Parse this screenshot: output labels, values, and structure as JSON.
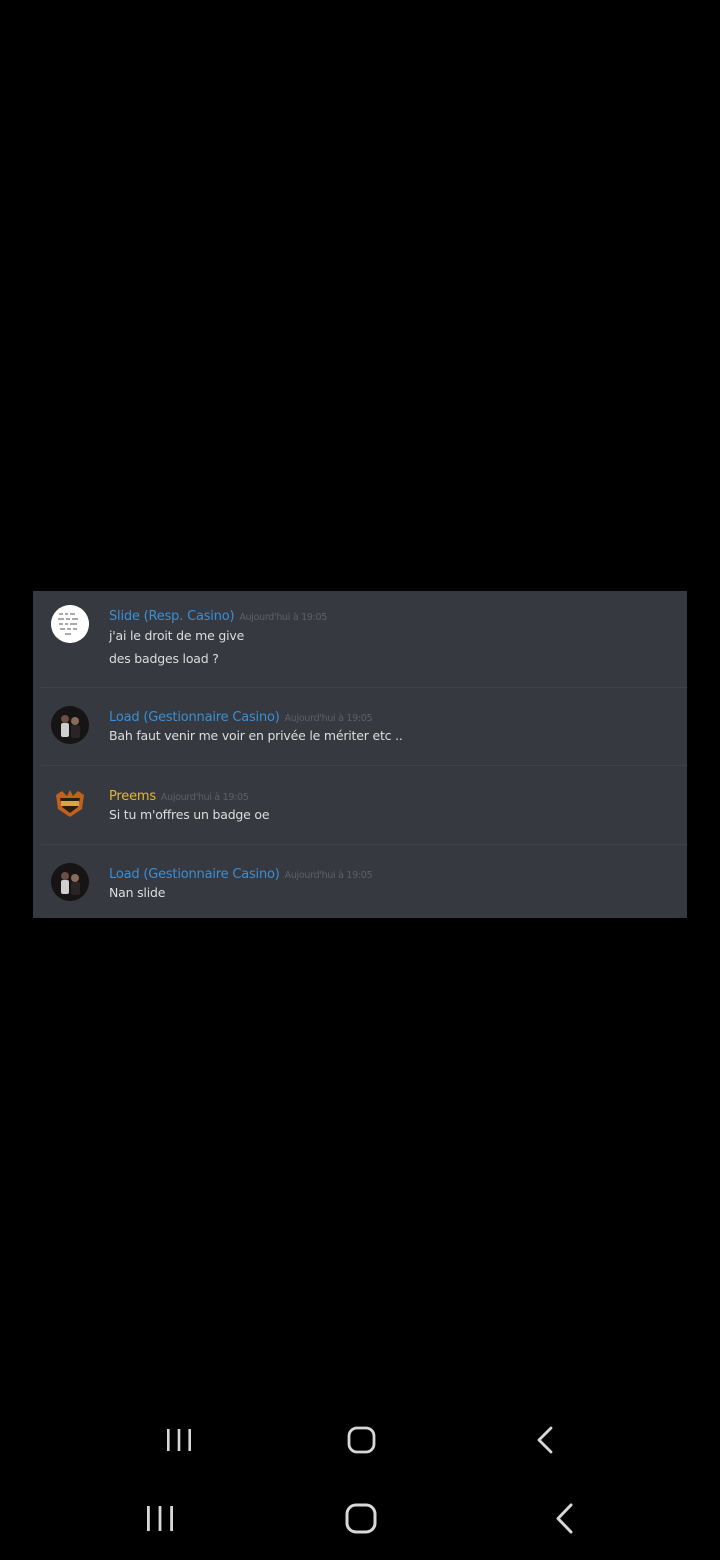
{
  "colors": {
    "background": "#000000",
    "panel": "#36393f",
    "divider": "#3f4248",
    "message_text": "#dcddde",
    "timestamp": "#5d6168",
    "role_blue": "#3a8fd6",
    "role_gold": "#e2b92b",
    "nav_icon": "#d8d8d8"
  },
  "chat": {
    "messages": [
      {
        "author": "Slide (Resp. Casino)",
        "author_color": "#3a8fd6",
        "timestamp": "Aujourd'hui à 19:05",
        "avatar": "scribble-text-avatar",
        "lines": [
          "j'ai le droit de me give",
          "des badges load ?"
        ]
      },
      {
        "author": "Load (Gestionnaire Casino)",
        "author_color": "#3a8fd6",
        "timestamp": "Aujourd'hui à 19:05",
        "avatar": "photo-avatar",
        "lines": [
          "Bah faut venir me voir en privée le mériter etc .."
        ]
      },
      {
        "author": "Preems",
        "author_color": "#e2b92b",
        "timestamp": "Aujourd'hui à 19:05",
        "avatar": "preems-logo-avatar",
        "lines": [
          "Si tu m'offres un badge oe"
        ]
      },
      {
        "author": "Load (Gestionnaire Casino)",
        "author_color": "#3a8fd6",
        "timestamp": "Aujourd'hui à 19:05",
        "avatar": "photo-avatar",
        "lines": [
          "Nan slide"
        ]
      }
    ]
  },
  "nav_bars": [
    {
      "buttons": [
        "recents-icon",
        "home-icon",
        "back-icon"
      ]
    },
    {
      "buttons": [
        "recents-icon",
        "home-icon",
        "back-icon"
      ]
    }
  ]
}
